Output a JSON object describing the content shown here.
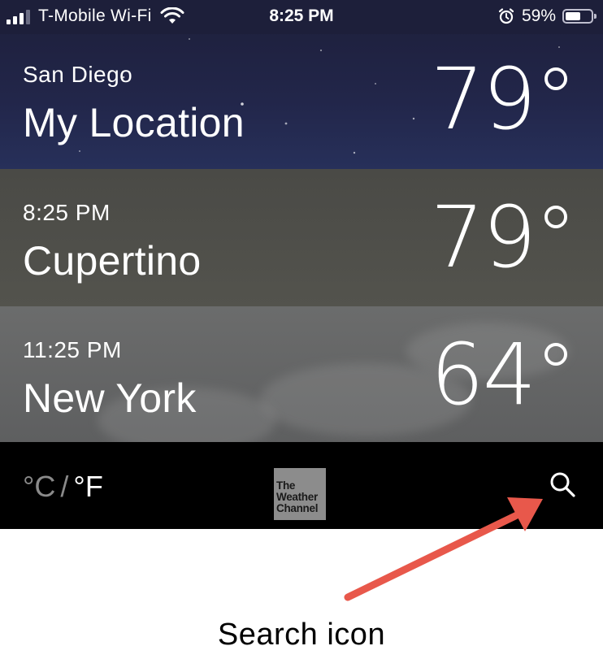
{
  "status_bar": {
    "carrier": "T-Mobile Wi-Fi",
    "time": "8:25 PM",
    "battery_percent": "59%",
    "battery_level": 0.59,
    "icons": [
      "signal-icon",
      "wifi-icon",
      "alarm-icon",
      "battery-icon"
    ]
  },
  "cities": [
    {
      "subtitle": "San Diego",
      "name": "My Location",
      "temperature": "79°"
    },
    {
      "subtitle": "8:25 PM",
      "name": "Cupertino",
      "temperature": "79°"
    },
    {
      "subtitle": "11:25 PM",
      "name": "New York",
      "temperature": "64°"
    }
  ],
  "toolbar": {
    "unit_celsius": "°C",
    "unit_separator": "/",
    "unit_fahrenheit": "°F",
    "logo_lines": [
      "The",
      "Weather",
      "Channel"
    ],
    "search_icon": "search-icon"
  },
  "annotation": {
    "caption": "Search icon",
    "arrow_color": "#e8584b"
  },
  "colors": {
    "row_1": "#1d1f3a",
    "row_2": "#4f4f4a",
    "row_3": "#666767",
    "toolbar": "#000000"
  }
}
